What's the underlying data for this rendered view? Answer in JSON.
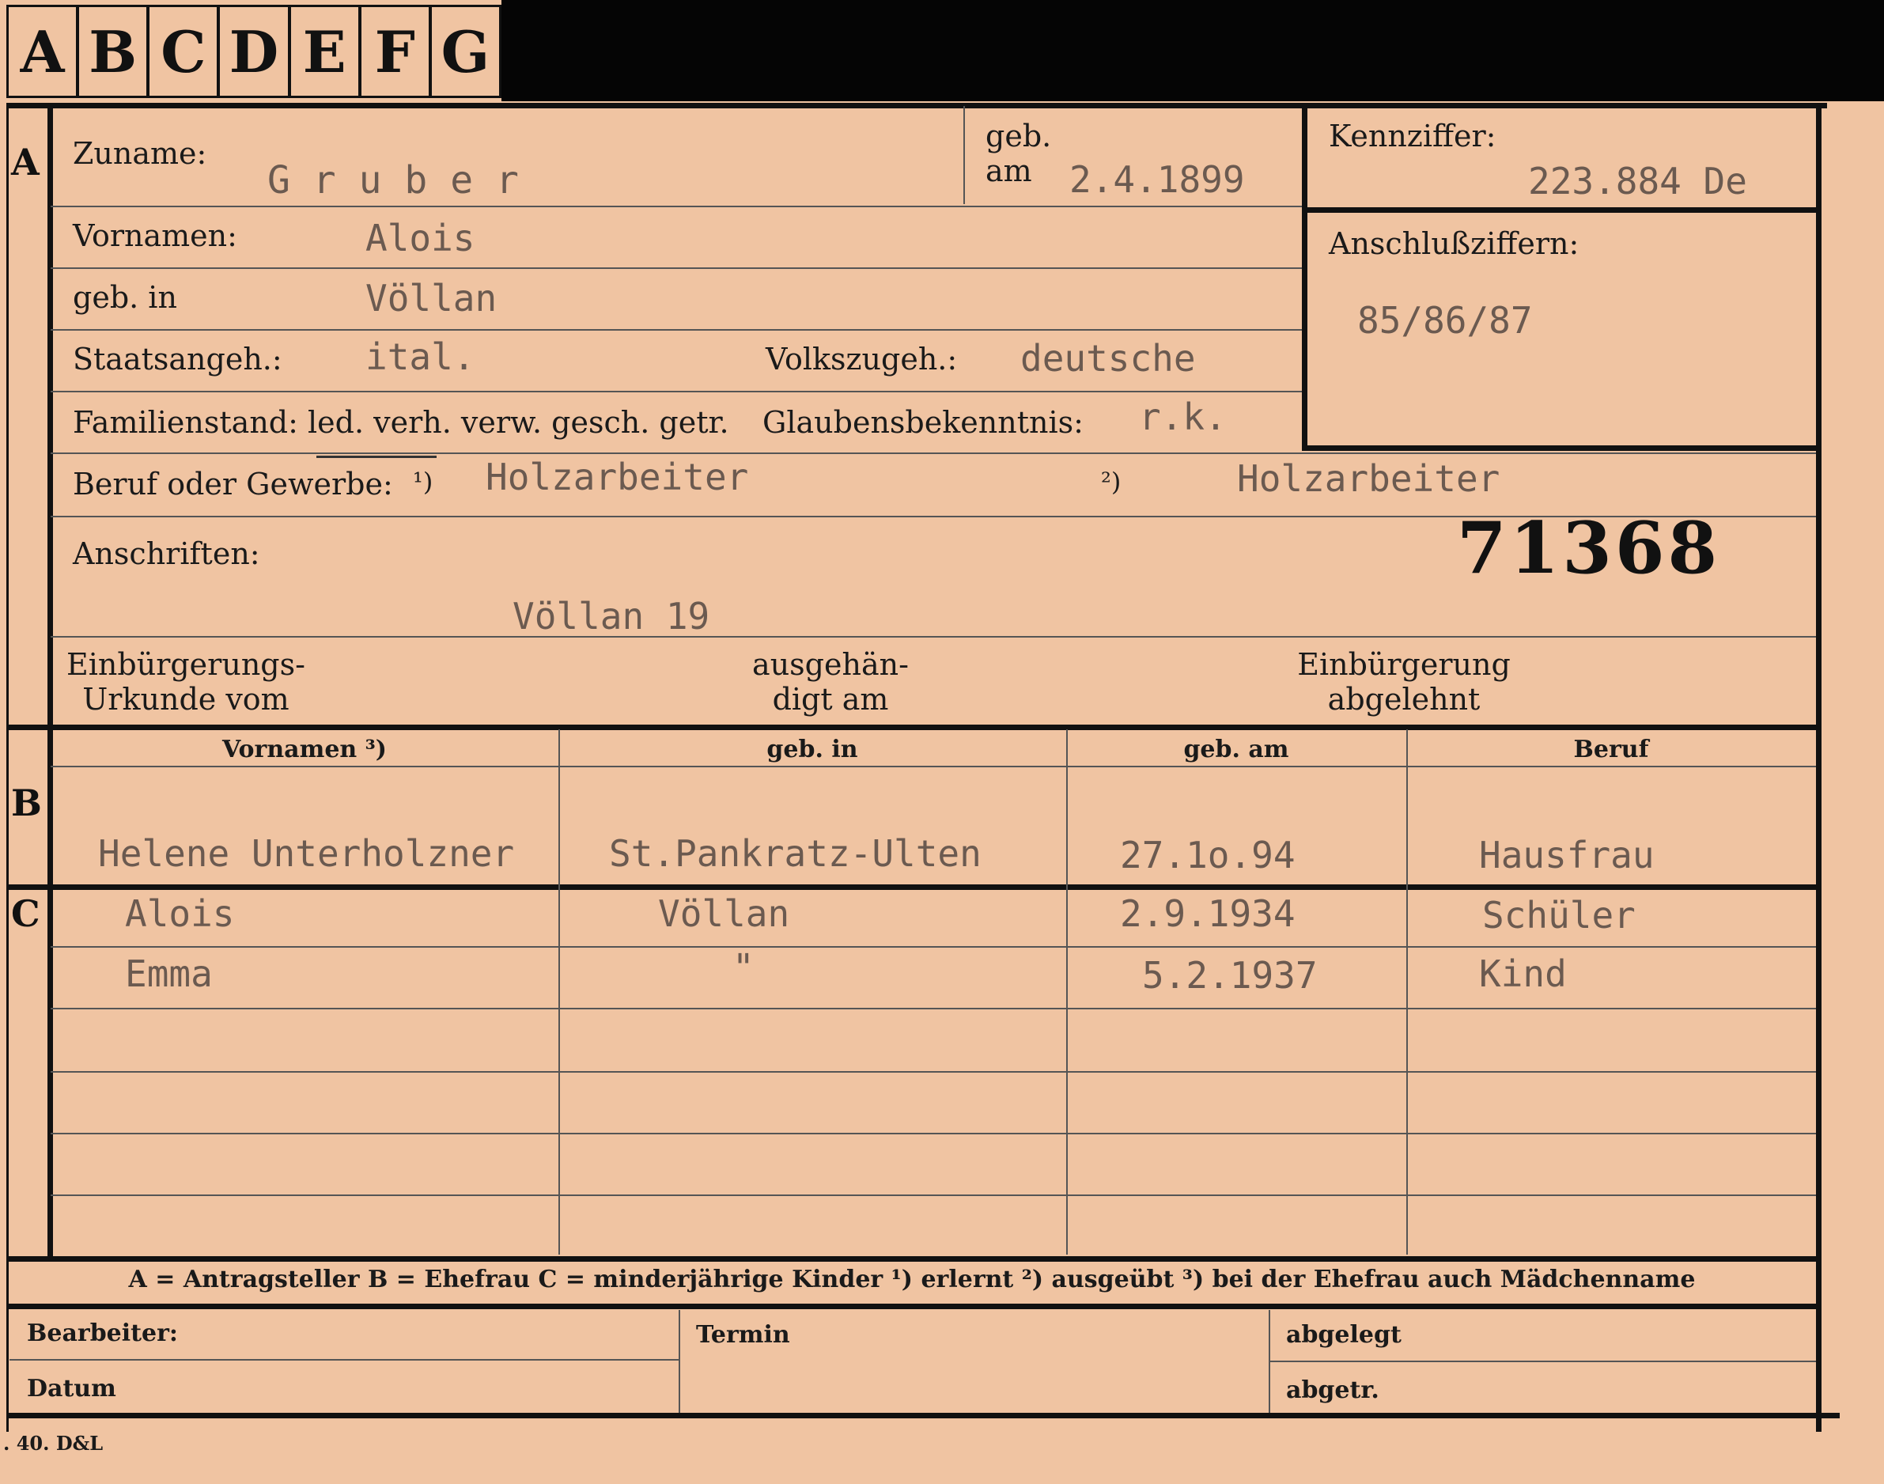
{
  "tabs": [
    "A",
    "B",
    "C",
    "D",
    "E",
    "F",
    "G"
  ],
  "sections": {
    "a": "A",
    "b": "B",
    "c": "C"
  },
  "header": {
    "zuname_label": "Zuname:",
    "zuname_value": "G r u b e r",
    "geb_label": "geb.",
    "am_label": "am",
    "geb_am_value": "2.4.1899",
    "kennziffer_label": "Kennziffer:",
    "kennziffer_value": "223.884 De",
    "anschluss_label": "Anschlußziffern:",
    "anschluss_value": "85/86/87"
  },
  "fields": {
    "vornamen_label": "Vornamen:",
    "vornamen_value": "Alois",
    "gebin_label": "geb. in",
    "gebin_value": "Völlan",
    "staat_label": "Staatsangeh.:",
    "staat_value": "ital.",
    "volk_label": "Volkszugeh.:",
    "volk_value": "deutsche",
    "familienstand_label": "Familienstand: led. verh. verw. gesch. getr.",
    "glauben_label": "Glaubensbekenntnis:",
    "glauben_value": "r.k.",
    "beruf_label": "Beruf oder Gewerbe:",
    "beruf_note1": "¹)",
    "beruf_value1": "Holzarbeiter",
    "beruf_note2": "²)",
    "beruf_value2": "Holzarbeiter",
    "anschriften_label": "Anschriften:",
    "anschriften_value": "Völlan 19",
    "stamp_number": "71368",
    "einb_urkunde_l1": "Einbürgerungs-",
    "einb_urkunde_l2": "Urkunde vom",
    "ausgehaendigt_l1": "ausgehän-",
    "ausgehaendigt_l2": "digt am",
    "einb_abgelehnt_l1": "Einbürgerung",
    "einb_abgelehnt_l2": "abgelehnt"
  },
  "table": {
    "headers": [
      "Vornamen ³)",
      "geb. in",
      "geb. am",
      "Beruf"
    ],
    "spouse": [
      "Helene Unterholzner",
      "St.Pankratz-Ulten",
      "27.1o.94",
      "Hausfrau"
    ],
    "children": [
      [
        "Alois",
        "Völlan",
        "2.9.1934",
        "Schüler"
      ],
      [
        "Emma",
        "\"",
        "5.2.1937",
        "Kind"
      ]
    ]
  },
  "legend": "A = Antragsteller   B = Ehefrau   C = minderjährige Kinder   ¹) erlernt   ²) ausgeübt   ³) bei der Ehefrau auch Mädchenname",
  "footer": {
    "bearbeiter": "Bearbeiter:",
    "datum": "Datum",
    "termin": "Termin",
    "abgelegt": "abgelegt",
    "abgetr": "abgetr.",
    "print_mark": ". 40. D&L"
  }
}
